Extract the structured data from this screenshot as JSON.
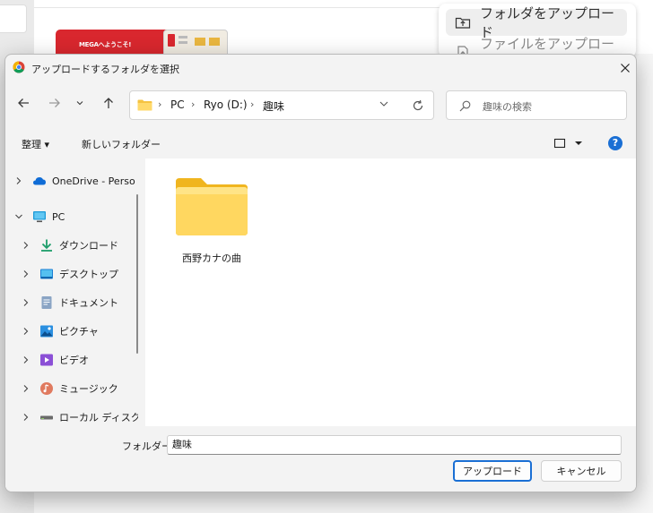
{
  "background": {
    "promo_text": "MEGAへようこそ!",
    "menu": [
      {
        "label": "フォルダをアップロード",
        "icon": "upload-folder-icon",
        "active": true
      },
      {
        "label": "ファイルをアップロード",
        "icon": "upload-file-icon",
        "active": false
      }
    ]
  },
  "dialog": {
    "title": "アップロードするフォルダを選択",
    "breadcrumb": [
      "PC",
      "Ryo (D:)",
      "趣味"
    ],
    "search_placeholder": "趣味の検索",
    "toolbar": {
      "organize": "整理 ▾",
      "new_folder": "新しいフォルダー",
      "help": "?"
    },
    "nav_items": [
      {
        "label": "OneDrive - Perso",
        "icon": "onedrive-icon",
        "expanded": false,
        "indent": 0
      },
      {
        "label": "PC",
        "icon": "pc-icon",
        "expanded": true,
        "indent": 0
      },
      {
        "label": "ダウンロード",
        "icon": "download-icon",
        "expanded": false,
        "indent": 1
      },
      {
        "label": "デスクトップ",
        "icon": "desktop-icon",
        "expanded": false,
        "indent": 1
      },
      {
        "label": "ドキュメント",
        "icon": "documents-icon",
        "expanded": false,
        "indent": 1
      },
      {
        "label": "ピクチャ",
        "icon": "pictures-icon",
        "expanded": false,
        "indent": 1
      },
      {
        "label": "ビデオ",
        "icon": "videos-icon",
        "expanded": false,
        "indent": 1
      },
      {
        "label": "ミュージック",
        "icon": "music-icon",
        "expanded": false,
        "indent": 1
      },
      {
        "label": "ローカル ディスク (",
        "icon": "drive-icon",
        "expanded": false,
        "indent": 1
      }
    ],
    "files": [
      {
        "label": "西野カナの曲",
        "icon": "folder-icon"
      }
    ],
    "folder_label": "フォルダー:",
    "folder_value": "趣味",
    "upload_button": "アップロード",
    "cancel_button": "キャンセル"
  }
}
